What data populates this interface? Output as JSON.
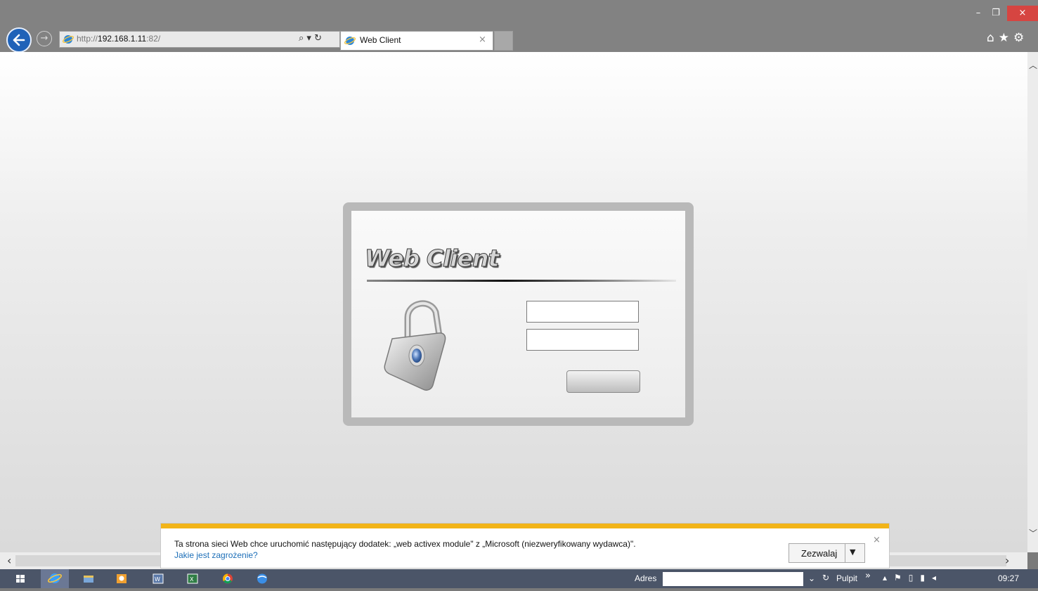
{
  "browser": {
    "window_controls": {
      "minimize": "–",
      "maximize": "❐",
      "close": "×"
    },
    "address": {
      "prefix": "http://",
      "host": "192.168.1.11",
      "suffix": ":82/"
    },
    "address_tools": "⌕ ▾ ↻",
    "tab": {
      "title": "Web Client",
      "close": "×"
    },
    "toolbar_icons": [
      "home-icon",
      "star-icon",
      "gear-icon"
    ],
    "toolbar_glyphs": "⌂★⚙"
  },
  "login": {
    "logo_text": "Web Client",
    "username_value": "",
    "password_value": ""
  },
  "notification": {
    "message": "Ta strona sieci Web chce uruchomić następujący dodatek: „web activex  module\" z „Microsoft (niezweryfikowany wydawca)\".",
    "link": "Jakie jest zagrożenie?",
    "allow_label": "Zezwalaj",
    "close": "×"
  },
  "taskbar": {
    "address_label": "Adres",
    "desktop_label": "Pulpit",
    "more": "»",
    "clock": "09:27",
    "pinned": [
      "start-icon",
      "ie-icon",
      "file-explorer-icon",
      "outlook-icon",
      "app-icon",
      "excel-icon",
      "chrome-icon",
      "network-icon"
    ]
  },
  "colors": {
    "chrome": "#828282",
    "close_button": "#d64541",
    "accent_notification": "#f2b418",
    "link": "#1d6fb8",
    "taskbar": "#4b5568"
  }
}
